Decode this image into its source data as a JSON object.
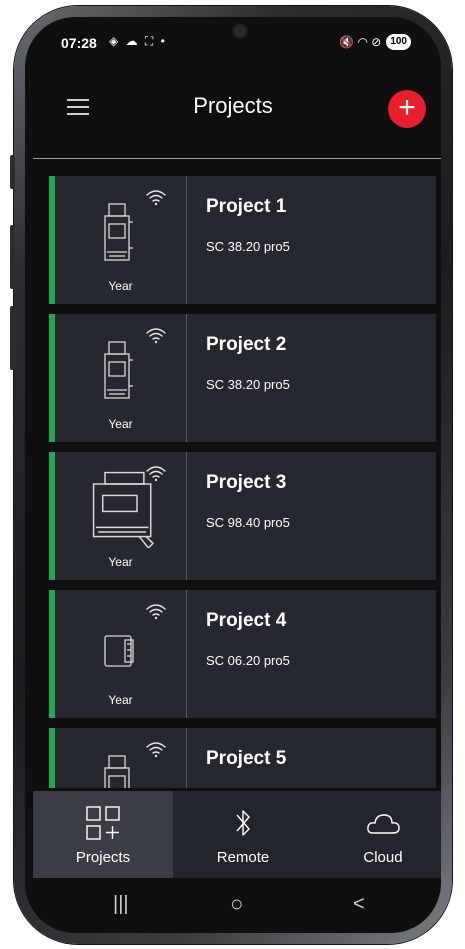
{
  "status_bar": {
    "time": "07:28",
    "left_icons": "◈ ☁ ⛶ •",
    "right_icons": "🔇 ◠ ⊘",
    "battery": "100"
  },
  "header": {
    "title": "Projects",
    "add_icon": "+"
  },
  "projects": [
    {
      "name": "Project 1",
      "model": "SC 38.20 pro5",
      "year": "Year",
      "device": "din-rail-narrow",
      "status_color": "#1faa4e"
    },
    {
      "name": "Project 2",
      "model": "SC 38.20 pro5",
      "year": "Year",
      "device": "din-rail-narrow",
      "status_color": "#1faa4e"
    },
    {
      "name": "Project 3",
      "model": "SC 98.40 pro5",
      "year": "Year",
      "device": "din-rail-wide",
      "status_color": "#1faa4e"
    },
    {
      "name": "Project 4",
      "model": "SC 06.20 pro5",
      "year": "Year",
      "device": "compact-module",
      "status_color": "#1faa4e"
    },
    {
      "name": "Project 5",
      "model": "",
      "year": "",
      "device": "din-rail-narrow",
      "status_color": "#1faa4e"
    }
  ],
  "bottom_nav": [
    {
      "label": "Projects",
      "icon": "grid-add-icon",
      "active": true
    },
    {
      "label": "Remote",
      "icon": "bluetooth-icon",
      "active": false
    },
    {
      "label": "Cloud",
      "icon": "cloud-icon",
      "active": false
    }
  ],
  "system_nav": {
    "recents": "|||",
    "home": "○",
    "back": "<"
  },
  "colors": {
    "accent_red": "#e8202e",
    "status_green": "#1faa4e",
    "card_bg": "#262830",
    "screen_bg": "#0f0f10"
  }
}
